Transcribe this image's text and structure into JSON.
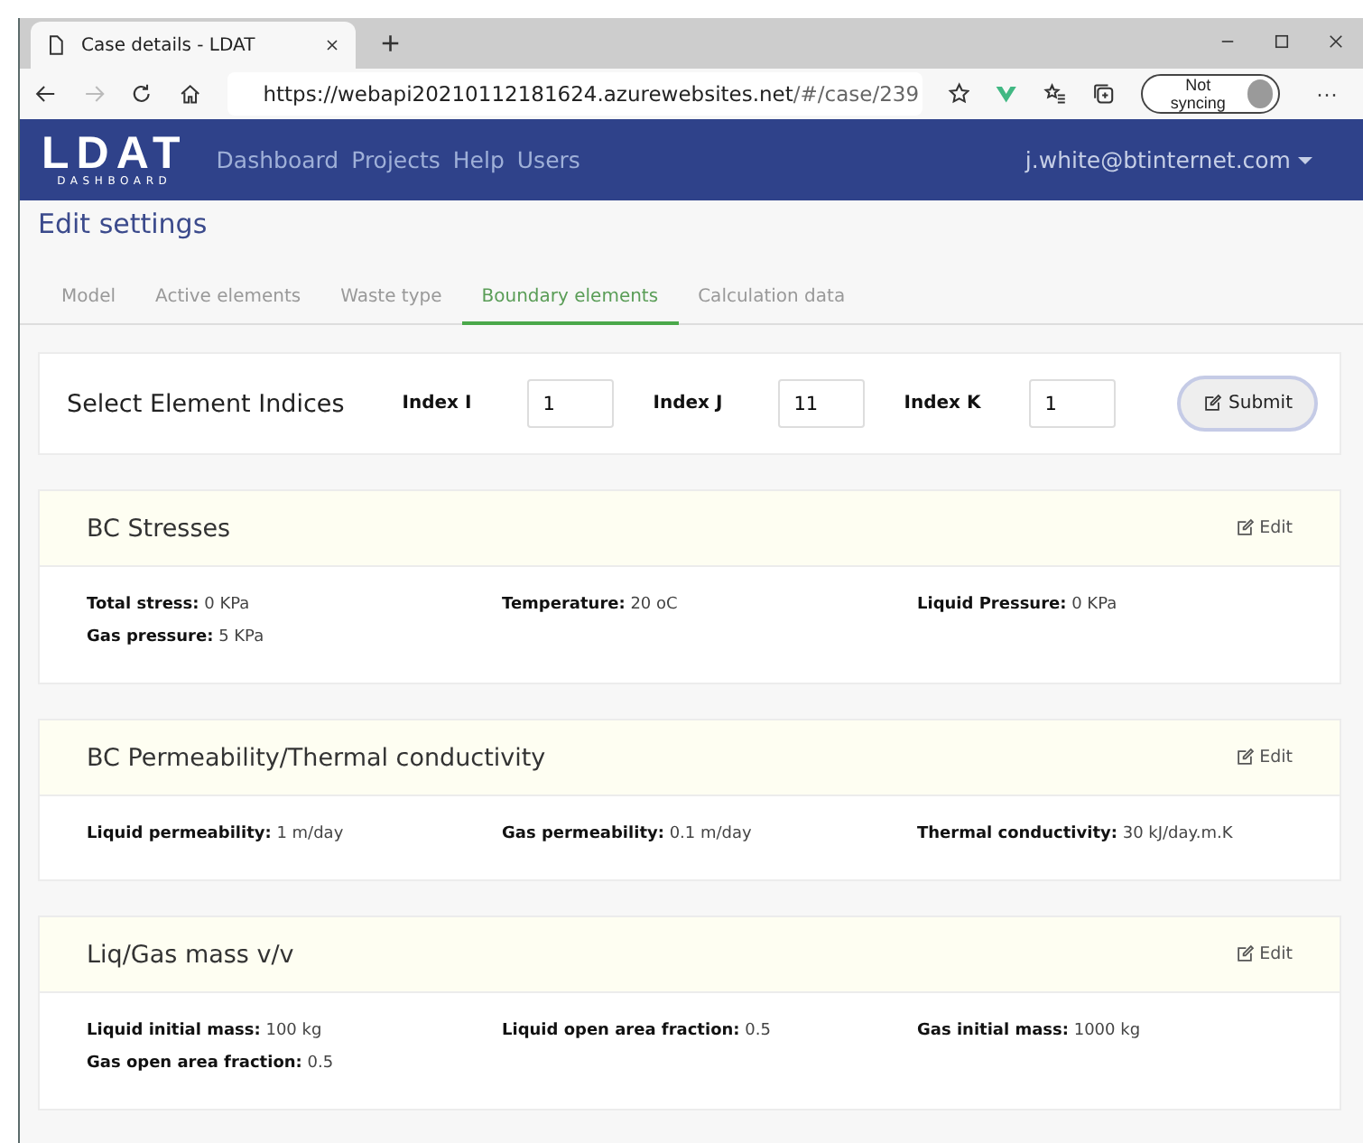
{
  "browser": {
    "tab_title": "Case details - LDAT",
    "new_tab": "+",
    "url_host": "https://webapi20210112181624.azurewebsites.net",
    "url_path": "/#/case/239",
    "sync_label": "Not syncing",
    "more": "···"
  },
  "navbar": {
    "logo": "LDAT",
    "logo_sub": "DASHBOARD",
    "links": [
      "Dashboard",
      "Projects",
      "Help",
      "Users"
    ],
    "user": "j.white@btinternet.com"
  },
  "page_title": "Edit settings",
  "tabs": [
    {
      "label": "Model",
      "selected": false
    },
    {
      "label": "Active elements",
      "selected": false
    },
    {
      "label": "Waste type",
      "selected": false
    },
    {
      "label": "Boundary elements",
      "selected": true
    },
    {
      "label": "Calculation data",
      "selected": false
    }
  ],
  "index_panel": {
    "title": "Select Element Indices",
    "fields": [
      {
        "label": "Index I",
        "value": "1"
      },
      {
        "label": "Index J",
        "value": "11"
      },
      {
        "label": "Index K",
        "value": "1"
      }
    ],
    "submit": "Submit"
  },
  "sections": [
    {
      "title": "BC Stresses",
      "edit": "Edit",
      "fields": [
        "**Total stress:** 0 KPa",
        "**Temperature:** 20 oC",
        "**Liquid Pressure:** 0 KPa",
        "**Gas pressure:** 5 KPa"
      ]
    },
    {
      "title": "BC Permeability/Thermal conductivity",
      "edit": "Edit",
      "fields": [
        "**Liquid permeability:** 1 m/day",
        "**Gas permeability:** 0.1 m/day",
        "**Thermal conductivity:** 30 kJ/day.m.K"
      ]
    },
    {
      "title": "Liq/Gas mass v/v",
      "edit": "Edit",
      "fields": [
        "**Liquid initial mass:** 100 kg",
        "**Liquid open area fraction:** 0.5",
        "**Gas initial mass:** 1000 kg",
        "**Gas open area fraction:** 0.5"
      ]
    }
  ]
}
